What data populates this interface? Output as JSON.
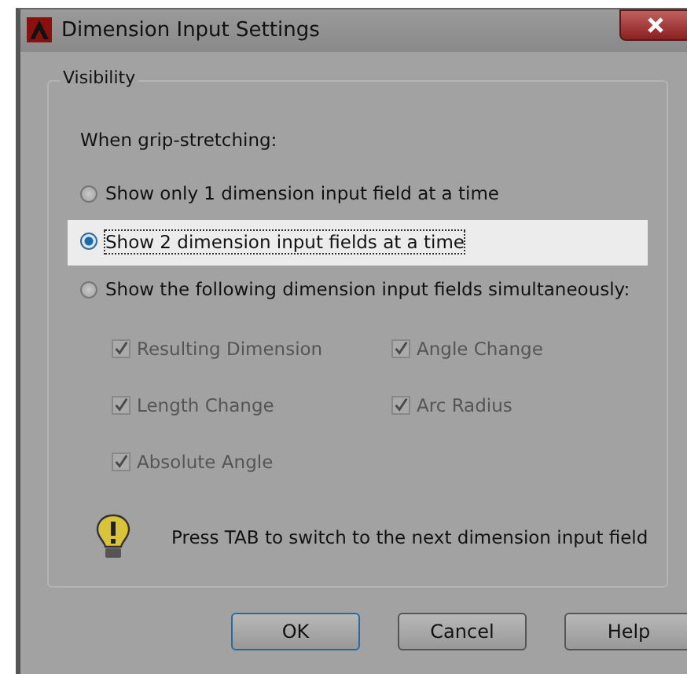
{
  "window": {
    "title": "Dimension Input Settings"
  },
  "group": {
    "title": "Visibility",
    "heading": "When grip-stretching:",
    "options": [
      {
        "label": "Show only 1 dimension input field at a time",
        "selected": false
      },
      {
        "label": "Show 2 dimension input fields at a time",
        "selected": true
      },
      {
        "label": "Show the following dimension input fields simultaneously:",
        "selected": false
      }
    ],
    "checkboxes": [
      {
        "label": "Resulting Dimension",
        "checked": true,
        "disabled": true
      },
      {
        "label": "Angle Change",
        "checked": true,
        "disabled": true
      },
      {
        "label": "Length Change",
        "checked": true,
        "disabled": true
      },
      {
        "label": "Arc Radius",
        "checked": true,
        "disabled": true
      },
      {
        "label": "Absolute Angle",
        "checked": true,
        "disabled": true
      }
    ],
    "tip": "Press TAB to switch to the next dimension input field"
  },
  "buttons": [
    {
      "label": "OK",
      "default": true
    },
    {
      "label": "Cancel",
      "default": false
    },
    {
      "label": "Help",
      "default": false
    }
  ]
}
